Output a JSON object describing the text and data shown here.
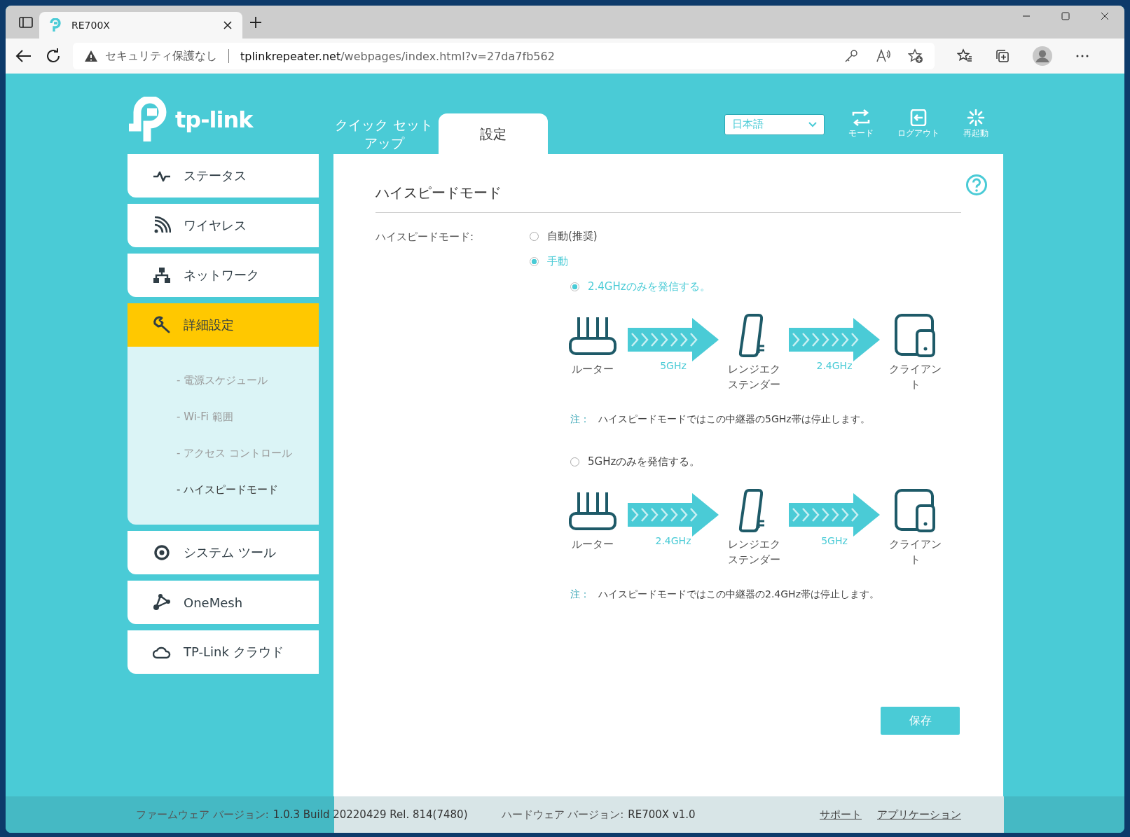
{
  "browser": {
    "tab_title": "RE700X",
    "security": "セキュリティ保護なし",
    "url_host": "tplinkrepeater.net",
    "url_path": "/webpages/index.html?v=27da7fb562"
  },
  "header": {
    "logo": "tp-link",
    "nav_tabs": [
      {
        "label": "クイック セットアップ",
        "selected": false
      },
      {
        "label": "設定",
        "selected": true
      }
    ],
    "language": "日本語",
    "actions": [
      {
        "kind": "mode",
        "label": "モード"
      },
      {
        "kind": "logout",
        "label": "ログアウト"
      },
      {
        "kind": "reboot",
        "label": "再起動"
      }
    ]
  },
  "sidebar": {
    "items": [
      {
        "kind": "status",
        "label": "ステータス",
        "selected": false
      },
      {
        "kind": "wireless",
        "label": "ワイヤレス",
        "selected": false
      },
      {
        "kind": "network",
        "label": "ネットワーク",
        "selected": false
      },
      {
        "kind": "advanced",
        "label": "詳細設定",
        "selected": true,
        "expanded": true,
        "children": [
          {
            "label": "- 電源スケジュール",
            "selected": false
          },
          {
            "label": "- Wi-Fi 範囲",
            "selected": false
          },
          {
            "label": "- アクセス コントロール",
            "selected": false
          },
          {
            "label": "- ハイスピードモード",
            "selected": true
          }
        ]
      },
      {
        "kind": "system",
        "label": "システム ツール",
        "selected": false
      },
      {
        "kind": "onemesh",
        "label": "OneMesh",
        "selected": false
      },
      {
        "kind": "cloud",
        "label": "TP-Link クラウド",
        "selected": false
      }
    ]
  },
  "content": {
    "title": "ハイスピードモード",
    "field_label": "ハイスピードモード:",
    "modes": [
      {
        "label": "自動(推奨)",
        "selected": false
      },
      {
        "label": "手動",
        "selected": true
      }
    ],
    "options": [
      {
        "label": "2.4GHzのみを発信する。",
        "selected": true,
        "devices": [
          {
            "kind": "router",
            "label": "ルーター"
          },
          {
            "kind": "extender",
            "label": "レンジエクステンダー"
          },
          {
            "kind": "client",
            "label": "クライアント"
          }
        ],
        "links": [
          "5GHz",
          "2.4GHz"
        ],
        "note_prefix": "注：",
        "note": "ハイスピードモードではこの中継器の5GHz帯は停止します。"
      },
      {
        "label": "5GHzのみを発信する。",
        "selected": false,
        "devices": [
          {
            "kind": "router",
            "label": "ルーター"
          },
          {
            "kind": "extender",
            "label": "レンジエクステンダー"
          },
          {
            "kind": "client",
            "label": "クライアント"
          }
        ],
        "links": [
          "2.4GHz",
          "5GHz"
        ],
        "note_prefix": "注：",
        "note": "ハイスピードモードではこの中継器の2.4GHz帯は停止します。"
      }
    ],
    "save": "保存"
  },
  "footer": {
    "firmware_label": "ファームウェア バージョン:",
    "firmware_value": "1.0.3 Build 20220429 Rel. 814(7480)",
    "hardware_label": "ハードウェア バージョン:",
    "hardware_value": "RE700X v1.0",
    "links": [
      "サポート",
      "アプリケーション"
    ]
  }
}
